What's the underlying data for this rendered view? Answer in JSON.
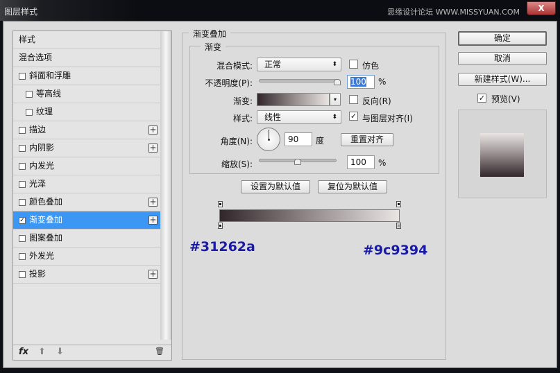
{
  "window": {
    "title": "图层样式",
    "watermark": "思缘设计论坛 WWW.MISSYUAN.COM",
    "close": "X"
  },
  "sidebar": {
    "items": [
      {
        "label": "样式",
        "checkbox": false,
        "plus": false
      },
      {
        "label": "混合选项",
        "checkbox": false,
        "plus": false
      },
      {
        "label": "斜面和浮雕",
        "checkbox": true,
        "checked": false,
        "plus": false
      },
      {
        "label": "等高线",
        "checkbox": true,
        "checked": false,
        "plus": false,
        "indent": true
      },
      {
        "label": "纹理",
        "checkbox": true,
        "checked": false,
        "plus": false,
        "indent": true
      },
      {
        "label": "描边",
        "checkbox": true,
        "checked": false,
        "plus": true
      },
      {
        "label": "内阴影",
        "checkbox": true,
        "checked": false,
        "plus": true
      },
      {
        "label": "内发光",
        "checkbox": true,
        "checked": false,
        "plus": false
      },
      {
        "label": "光泽",
        "checkbox": true,
        "checked": false,
        "plus": false
      },
      {
        "label": "颜色叠加",
        "checkbox": true,
        "checked": false,
        "plus": true
      },
      {
        "label": "渐变叠加",
        "checkbox": true,
        "checked": true,
        "plus": true,
        "selected": true
      },
      {
        "label": "图案叠加",
        "checkbox": true,
        "checked": false,
        "plus": false
      },
      {
        "label": "外发光",
        "checkbox": true,
        "checked": false,
        "plus": false
      },
      {
        "label": "投影",
        "checkbox": true,
        "checked": false,
        "plus": true
      }
    ],
    "footer": {
      "fx": "fx",
      "up": "⬆",
      "down": "⬇",
      "trash": "🗑"
    }
  },
  "main": {
    "group_title": "渐变叠加",
    "sub_title": "渐变",
    "blend_label": "混合模式:",
    "blend_value": "正常",
    "dither_label": "仿色",
    "opacity_label": "不透明度(P):",
    "opacity_value": "100",
    "opacity_percent": 100,
    "pct": "%",
    "gradient_label": "渐变:",
    "reverse_label": "反向(R)",
    "style_label": "样式:",
    "style_value": "线性",
    "align_label": "与图层对齐(I)",
    "angle_label": "角度(N):",
    "angle_value": "90",
    "angle_unit": "度",
    "reset_align": "重置对齐",
    "scale_label": "缩放(S):",
    "scale_value": "100",
    "scale_percent": 100,
    "set_default": "设置为默认值",
    "reset_default": "复位为默认值",
    "color_start": "#31262a",
    "color_end": "#9c9394"
  },
  "right": {
    "ok": "确定",
    "cancel": "取消",
    "new_style": "新建样式(W)...",
    "preview_label": "预览(V)",
    "preview_checked": true
  }
}
